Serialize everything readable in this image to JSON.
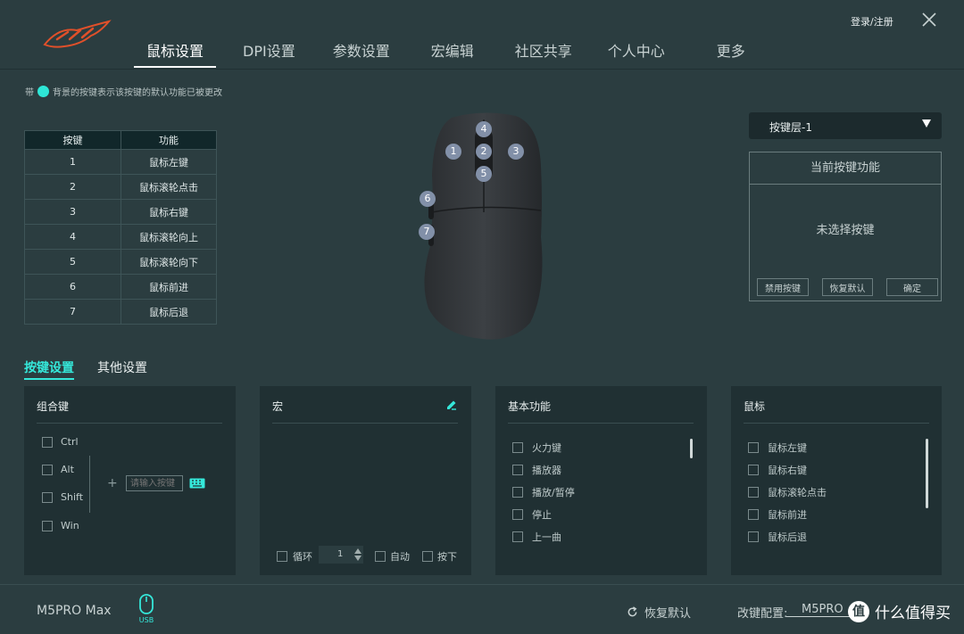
{
  "nav": {
    "items": [
      "鼠标设置",
      "DPI设置",
      "参数设置",
      "宏编辑",
      "社区共享",
      "个人中心",
      "更多"
    ],
    "active_index": 0
  },
  "header": {
    "login_label": "登录/注册"
  },
  "hint": {
    "prefix": "带",
    "text": "背景的按键表示该按键的默认功能已被更改",
    "dot_color": "#2ee6d6"
  },
  "key_table": {
    "headers": [
      "按键",
      "功能"
    ],
    "rows": [
      [
        "1",
        "鼠标左键"
      ],
      [
        "2",
        "鼠标滚轮点击"
      ],
      [
        "3",
        "鼠标右键"
      ],
      [
        "4",
        "鼠标滚轮向上"
      ],
      [
        "5",
        "鼠标滚轮向下"
      ],
      [
        "6",
        "鼠标前进"
      ],
      [
        "7",
        "鼠标后退"
      ]
    ]
  },
  "mouse_badges": [
    "1",
    "2",
    "3",
    "4",
    "5",
    "6",
    "7"
  ],
  "layer": {
    "selected": "按键层-1"
  },
  "current_function": {
    "title": "当前按键功能",
    "empty_text": "未选择按键",
    "disable_label": "禁用按键",
    "restore_label": "恢复默认",
    "confirm_label": "确定"
  },
  "subtabs": {
    "items": [
      "按键设置",
      "其他设置"
    ],
    "active_index": 0
  },
  "combo_panel": {
    "title": "组合键",
    "modifiers": [
      "Ctrl",
      "Alt",
      "Shift",
      "Win"
    ],
    "plus": "+",
    "input_placeholder": "请输入按键"
  },
  "macro_panel": {
    "title": "宏",
    "loop_label": "循环",
    "loop_count": "1",
    "auto_label": "自动",
    "press_label": "按下"
  },
  "basic_panel": {
    "title": "基本功能",
    "items": [
      "火力键",
      "播放器",
      "播放/暂停",
      "停止",
      "上一曲"
    ]
  },
  "mouse_panel": {
    "title": "鼠标",
    "items": [
      "鼠标左键",
      "鼠标右键",
      "鼠标滚轮点击",
      "鼠标前进",
      "鼠标后退"
    ]
  },
  "footer": {
    "model": "M5PRO Max",
    "usb_label": "USB",
    "restore_label": "恢复默认",
    "config_label": "改键配置:",
    "config_value": "M5PRO",
    "watermark_symbol": "值",
    "watermark_text": "什么值得买"
  },
  "colors": {
    "accent": "#35e8da",
    "background": "#2b3d40",
    "panel": "#203033"
  }
}
